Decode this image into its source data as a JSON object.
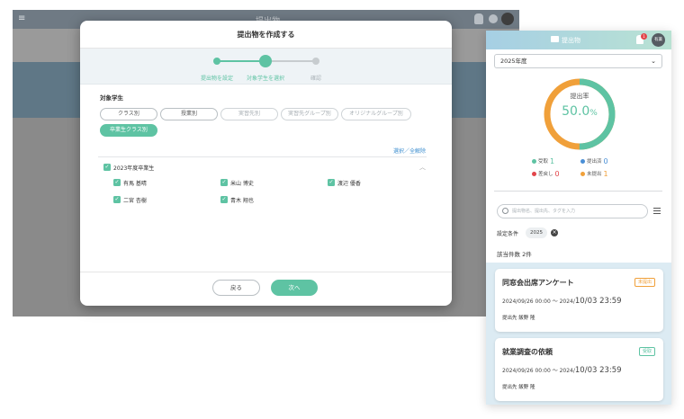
{
  "background_app": {
    "title": "提出物"
  },
  "modal": {
    "title": "提出物を作成する",
    "steps": [
      {
        "label": "提出物を設定",
        "state": "done"
      },
      {
        "label": "対象学生を選択",
        "state": "current"
      },
      {
        "label": "確認",
        "state": "todo"
      }
    ],
    "section_label": "対象学生",
    "filter_chips": [
      {
        "label": "クラス別",
        "state": "normal"
      },
      {
        "label": "授業別",
        "state": "normal"
      },
      {
        "label": "実習先別",
        "state": "faded"
      },
      {
        "label": "実習先グループ別",
        "state": "faded"
      },
      {
        "label": "オリジナルグループ別",
        "state": "faded"
      },
      {
        "label": "卒業生クラス別",
        "state": "active"
      }
    ],
    "select_toggle": "選択／全解除",
    "group": {
      "label": "2023年度卒業生",
      "checked": true,
      "students": [
        {
          "name": "有馬 基晴",
          "checked": true
        },
        {
          "name": "米山 博史",
          "checked": true
        },
        {
          "name": "渡辺 優香",
          "checked": true
        },
        {
          "name": "二宮 杏樹",
          "checked": true
        },
        {
          "name": "青木 翔也",
          "checked": true
        }
      ]
    },
    "buttons": {
      "back": "戻る",
      "next": "次へ"
    }
  },
  "mobile": {
    "header_title": "提出物",
    "notification_count": "1",
    "avatar_text": "有薬",
    "year_select": "2025年度",
    "donut": {
      "label": "提出率",
      "value": "50.0",
      "unit": "%",
      "fraction_submitted": 0.5
    },
    "stats": [
      {
        "label": "受取",
        "value": "1",
        "color": "#5ec3a3"
      },
      {
        "label": "提出済",
        "value": "0",
        "color": "#4a8fd6"
      },
      {
        "label": "差戻し",
        "value": "0",
        "color": "#e2454a"
      },
      {
        "label": "未提出",
        "value": "1",
        "color": "#f0a03a"
      }
    ],
    "search_placeholder": "提出物名、提出先、タグを入力",
    "condition_label": "設定条件",
    "condition_value": "2025",
    "result_count": "該当件数 2件",
    "cards": [
      {
        "title": "同窓会出席アンケート",
        "badge": "未提出",
        "badge_color": "#f0a03a",
        "date_small": "2024/09/26 00:00 〜 2024/",
        "date_big": "10/03 23:59",
        "owner": "提出先 飯野 隆"
      },
      {
        "title": "就業調査の依頼",
        "badge": "受取",
        "badge_color": "#5ec3a3",
        "date_small": "2024/09/26 00:00 〜 2024/",
        "date_big": "10/03 23:59",
        "owner": "提出先 飯野 隆"
      }
    ]
  }
}
